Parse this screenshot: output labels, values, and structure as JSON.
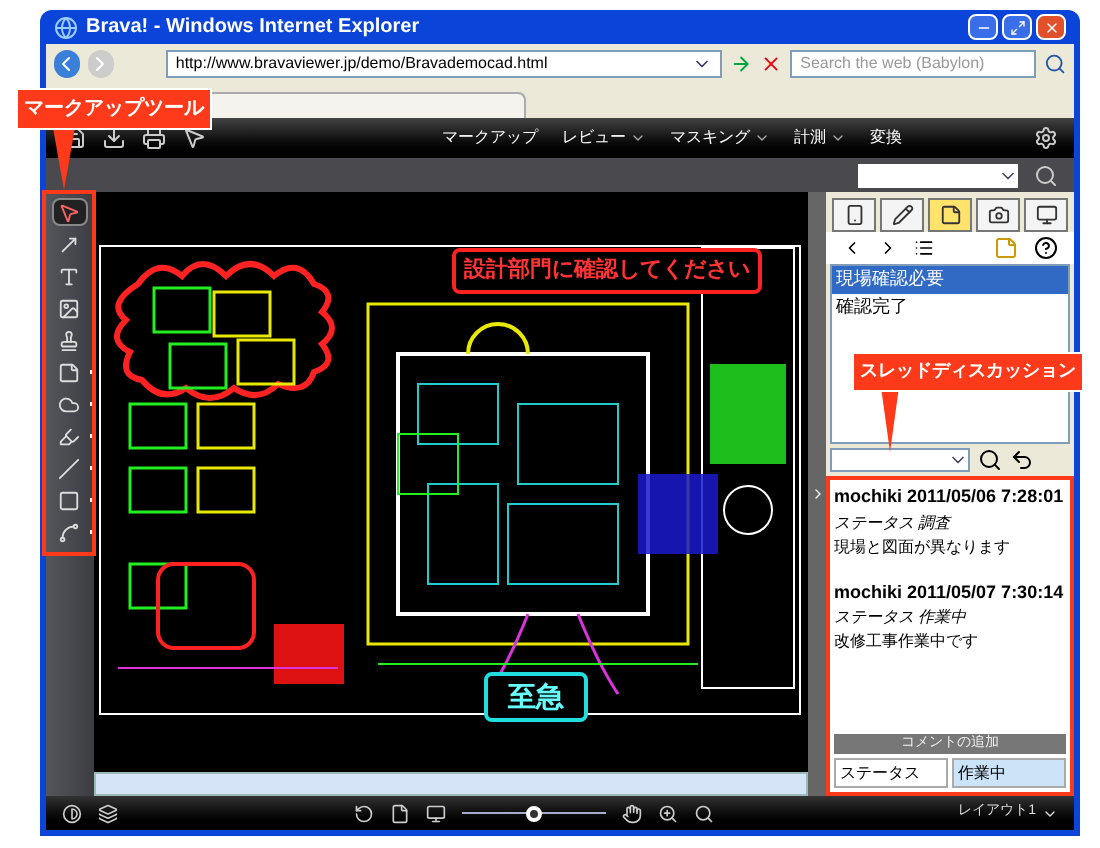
{
  "window": {
    "title": "Brava! - Windows Internet Explorer"
  },
  "address_bar": {
    "url": "http://www.bravaviewer.jp/demo/Bravademocad.html"
  },
  "search": {
    "placeholder": "Search the web (Babylon)"
  },
  "viewer_menu": [
    {
      "label": "マークアップ",
      "dropdown": false
    },
    {
      "label": "レビュー",
      "dropdown": true
    },
    {
      "label": "マスキング",
      "dropdown": true
    },
    {
      "label": "計測",
      "dropdown": true
    },
    {
      "label": "変換",
      "dropdown": false
    }
  ],
  "markup_tools": [
    {
      "kind": "select",
      "selected": true,
      "submenu": false
    },
    {
      "kind": "arrow",
      "selected": false,
      "submenu": false
    },
    {
      "kind": "text",
      "selected": false,
      "submenu": false
    },
    {
      "kind": "image",
      "selected": false,
      "submenu": false
    },
    {
      "kind": "stamp",
      "selected": false,
      "submenu": false
    },
    {
      "kind": "note",
      "selected": false,
      "submenu": true
    },
    {
      "kind": "cloud",
      "selected": false,
      "submenu": true
    },
    {
      "kind": "highlighter",
      "selected": false,
      "submenu": true
    },
    {
      "kind": "line",
      "selected": false,
      "submenu": true
    },
    {
      "kind": "rectangle",
      "selected": false,
      "submenu": true
    },
    {
      "kind": "polyline",
      "selected": false,
      "submenu": true
    }
  ],
  "panel": {
    "tabs": [
      {
        "kind": "device",
        "selected": false
      },
      {
        "kind": "pencil",
        "selected": false
      },
      {
        "kind": "note",
        "selected": true
      },
      {
        "kind": "camera",
        "selected": false
      },
      {
        "kind": "monitor",
        "selected": false
      }
    ],
    "list": [
      {
        "label": "現場確認必要",
        "selected": true
      },
      {
        "label": "確認完了",
        "selected": false
      }
    ],
    "thread": [
      {
        "header": "mochiki 2011/05/06 7:28:01",
        "status": "ステータス 調査",
        "text": "現場と図面が異なります"
      },
      {
        "header": "mochiki 2011/05/07 7:30:14",
        "status": "ステータス 作業中",
        "text": "改修工事作業中です"
      }
    ],
    "add_comment": "コメントの追加",
    "status_field": {
      "label": "ステータス",
      "value": "作業中"
    }
  },
  "zoom": {
    "level": 0.5
  },
  "layout": {
    "value": "レイアウト1"
  },
  "callouts": {
    "tools": "マークアップツール",
    "canvas_note": "設計部門に確認してください",
    "thread": "スレッドディスカッション",
    "urgent": "至急"
  }
}
